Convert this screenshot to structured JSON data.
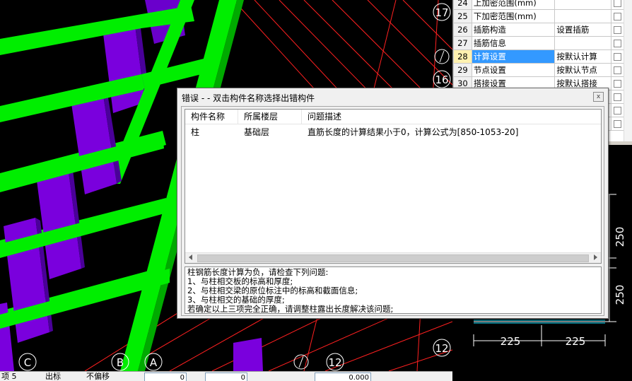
{
  "viewport": {
    "axis_labels": [
      "17",
      "16",
      "12",
      "12",
      "C",
      "B",
      "A"
    ],
    "colors": {
      "beam": "#00ee00",
      "column": "#7a00dd",
      "gridline": "#ff2020",
      "axis_marker": "#ffffff"
    }
  },
  "statusbar": {
    "item1": "项 5",
    "item2": "出标",
    "item3": "不偏移",
    "value1": "0",
    "value2": "0",
    "value3": "0.000"
  },
  "property_grid": {
    "rows": [
      {
        "num": "24",
        "name": "上加密范围(mm)",
        "value": ""
      },
      {
        "num": "25",
        "name": "下加密范围(mm)",
        "value": ""
      },
      {
        "num": "26",
        "name": "插筋构造",
        "value": "设置插筋"
      },
      {
        "num": "27",
        "name": "插筋信息",
        "value": ""
      },
      {
        "num": "28",
        "name": "计算设置",
        "value": "按默认计算"
      },
      {
        "num": "29",
        "name": "节点设置",
        "value": "按默认节点"
      },
      {
        "num": "30",
        "name": "搭接设置",
        "value": "按默认搭接"
      },
      {
        "num": "",
        "name": "",
        "value": ""
      },
      {
        "num": "",
        "name": "",
        "value": ""
      },
      {
        "num": "",
        "name": "",
        "value": ""
      }
    ],
    "selected_row": "28"
  },
  "drawing": {
    "dims": [
      "250",
      "250",
      "225",
      "225"
    ]
  },
  "dialog": {
    "title": "错误 - - 双击构件名称选择出错构件",
    "close_glyph": "x",
    "columns": [
      "构件名称",
      "所属楼层",
      "问题描述"
    ],
    "rows": [
      {
        "name": "柱",
        "floor": "基础层",
        "description": "直筋长度的计算结果小于0，计算公式为[850-1053-20]"
      }
    ],
    "message": [
      "柱钢筋长度计算为负，请检查下列问题:",
      "1、与柱相交板的标高和厚度;",
      "2、与柱相交梁的原位标注中的标高和截面信息;",
      "3、与柱相交的基础的厚度;",
      "若确定以上三项完全正确，请调整柱露出长度解决该问题;"
    ]
  }
}
